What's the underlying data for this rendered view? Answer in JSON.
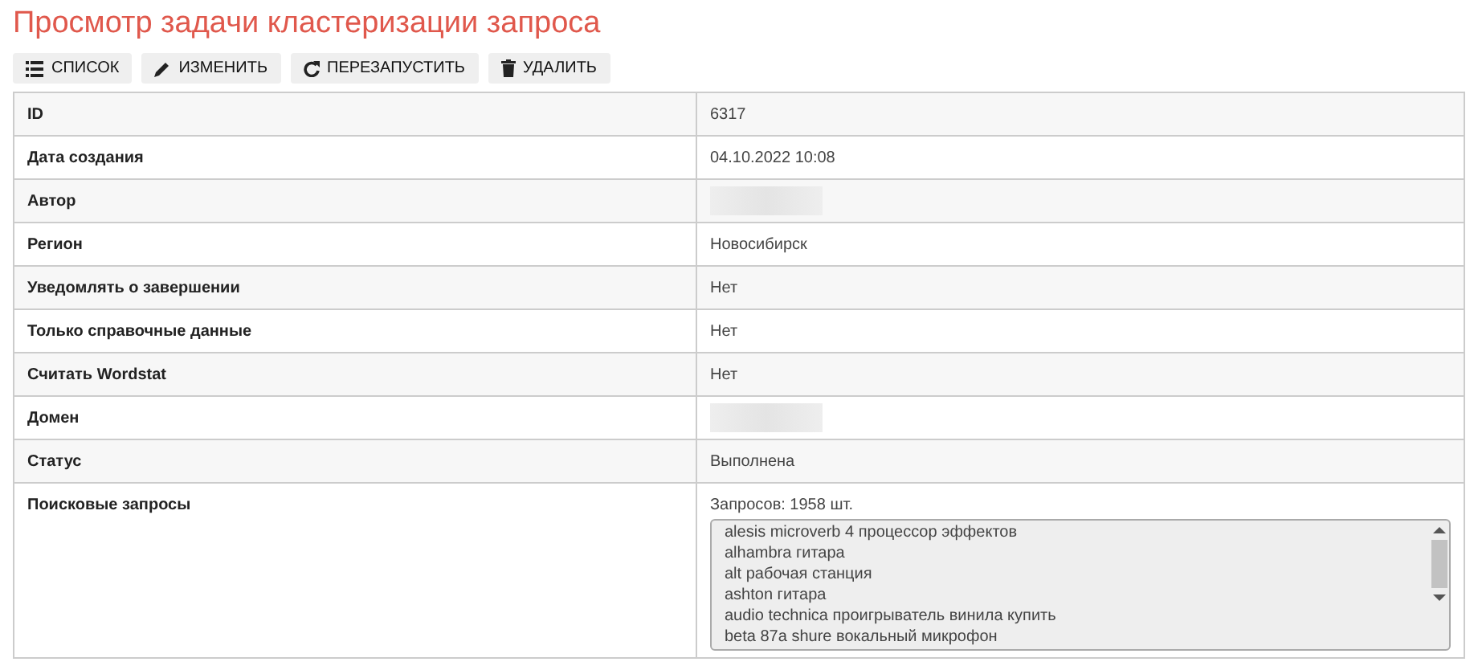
{
  "title": "Просмотр задачи кластеризации запроса",
  "toolbar": [
    {
      "label": "СПИСОК",
      "kind": "list"
    },
    {
      "label": "ИЗМЕНИТЬ",
      "kind": "edit"
    },
    {
      "label": "ПЕРЕЗАПУСТИТЬ",
      "kind": "restart"
    },
    {
      "label": "УДАЛИТЬ",
      "kind": "delete"
    }
  ],
  "rows": [
    {
      "label": "ID",
      "kind": "text",
      "value": "6317"
    },
    {
      "label": "Дата создания",
      "kind": "text",
      "value": "04.10.2022 10:08"
    },
    {
      "label": "Автор",
      "kind": "blurred"
    },
    {
      "label": "Регион",
      "kind": "text",
      "value": "Новосибирск"
    },
    {
      "label": "Уведомлять о завершении",
      "kind": "text",
      "value": "Нет"
    },
    {
      "label": "Только справочные данные",
      "kind": "text",
      "value": "Нет"
    },
    {
      "label": "Считать Wordstat",
      "kind": "text",
      "value": "Нет"
    },
    {
      "label": "Домен",
      "kind": "blurred"
    },
    {
      "label": "Статус",
      "kind": "text",
      "value": "Выполнена"
    },
    {
      "label": "Поисковые запросы",
      "kind": "queries",
      "value": "Запросов: 1958 шт.",
      "items": [
        "alesis microverb 4 процессор эффектов",
        "alhambra гитара",
        "alt рабочая станция",
        "ashton гитара",
        "audio technica проигрыватель винила купить",
        "beta 87a shure вокальный микрофон"
      ]
    }
  ]
}
